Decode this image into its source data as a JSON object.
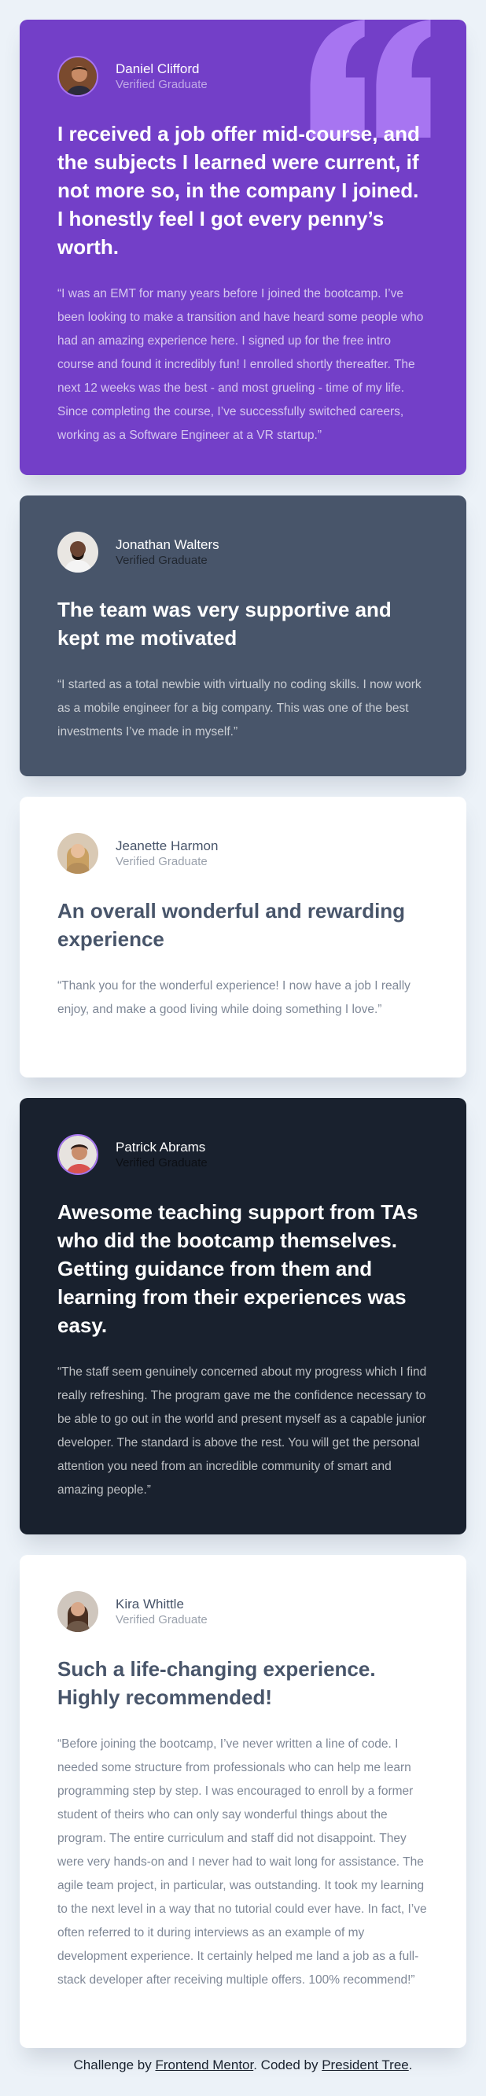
{
  "testimonials": [
    {
      "name": "Daniel Clifford",
      "role": "Verified Graduate",
      "headline": "I received a job offer mid-course, and the subjects I learned were current, if not more so, in the company I joined. I honestly feel I got every penny’s worth.",
      "quote": "“I was an EMT for many years before I joined the bootcamp. I’ve been looking to make a transition and have heard some people who had an amazing experience here. I signed up for the free intro course and found it incredibly fun! I enrolled shortly thereafter. The next 12 weeks was the best - and most grueling - time of my life. Since completing the course, I’ve successfully switched careers, working as a Software Engineer at a VR startup.”",
      "background": "#733fc8"
    },
    {
      "name": "Jonathan Walters",
      "role": "Verified Graduate",
      "headline": "The team was very supportive and kept me motivated",
      "quote": "“I started as a total newbie with virtually no coding skills. I now work as a mobile engineer for a big company. This was one of the best investments I’ve made in myself.”",
      "background": "#48556a"
    },
    {
      "name": "Jeanette Harmon",
      "role": "Verified Graduate",
      "headline": "An overall wonderful and rewarding experience",
      "quote": "“Thank you for the wonderful experience! I now have a job I really enjoy, and make a good living while doing something I love.”",
      "background": "#ffffff"
    },
    {
      "name": "Patrick Abrams",
      "role": "Verified Graduate",
      "headline": "Awesome teaching support from TAs who did the bootcamp themselves. Getting guidance from them and learning from their experiences was easy.",
      "quote": "“The staff seem genuinely concerned about my progress which I find really refreshing. The program gave me the confidence necessary to be able to go out in the world and present myself as a capable junior developer. The standard is above the rest. You will get the personal attention you need from an incredible community of smart and amazing people.”",
      "background": "#19212e"
    },
    {
      "name": "Kira Whittle",
      "role": "Verified Graduate",
      "headline": "Such a life-changing experience. Highly recommended!",
      "quote": "“Before joining the bootcamp, I’ve never written a line of code. I needed some structure from professionals who can help me learn programming step by step. I was encouraged to enroll by a former student of theirs who can only say wonderful things about the program. The entire curriculum and staff did not disappoint. They were very hands-on and I never had to wait long for assistance. The agile team project, in particular, was outstanding. It took my learning to the next level in a way that no tutorial could ever have. In fact, I’ve often referred to it during interviews as an example of my development experience. It certainly helped me land a job as a full-stack developer after receiving multiple offers. 100% recommend!”",
      "background": "#ffffff"
    }
  ],
  "attribution": {
    "prefix": "Challenge by ",
    "mentor_link": "Frontend Mentor",
    "middle": ". Coded by ",
    "author_link": "President Tree",
    "suffix": "."
  },
  "icons": {
    "quote_mark": "quotation-mark-icon"
  },
  "colors": {
    "page_background": "#ecf2f8",
    "quote_mark": "#a775f1"
  }
}
